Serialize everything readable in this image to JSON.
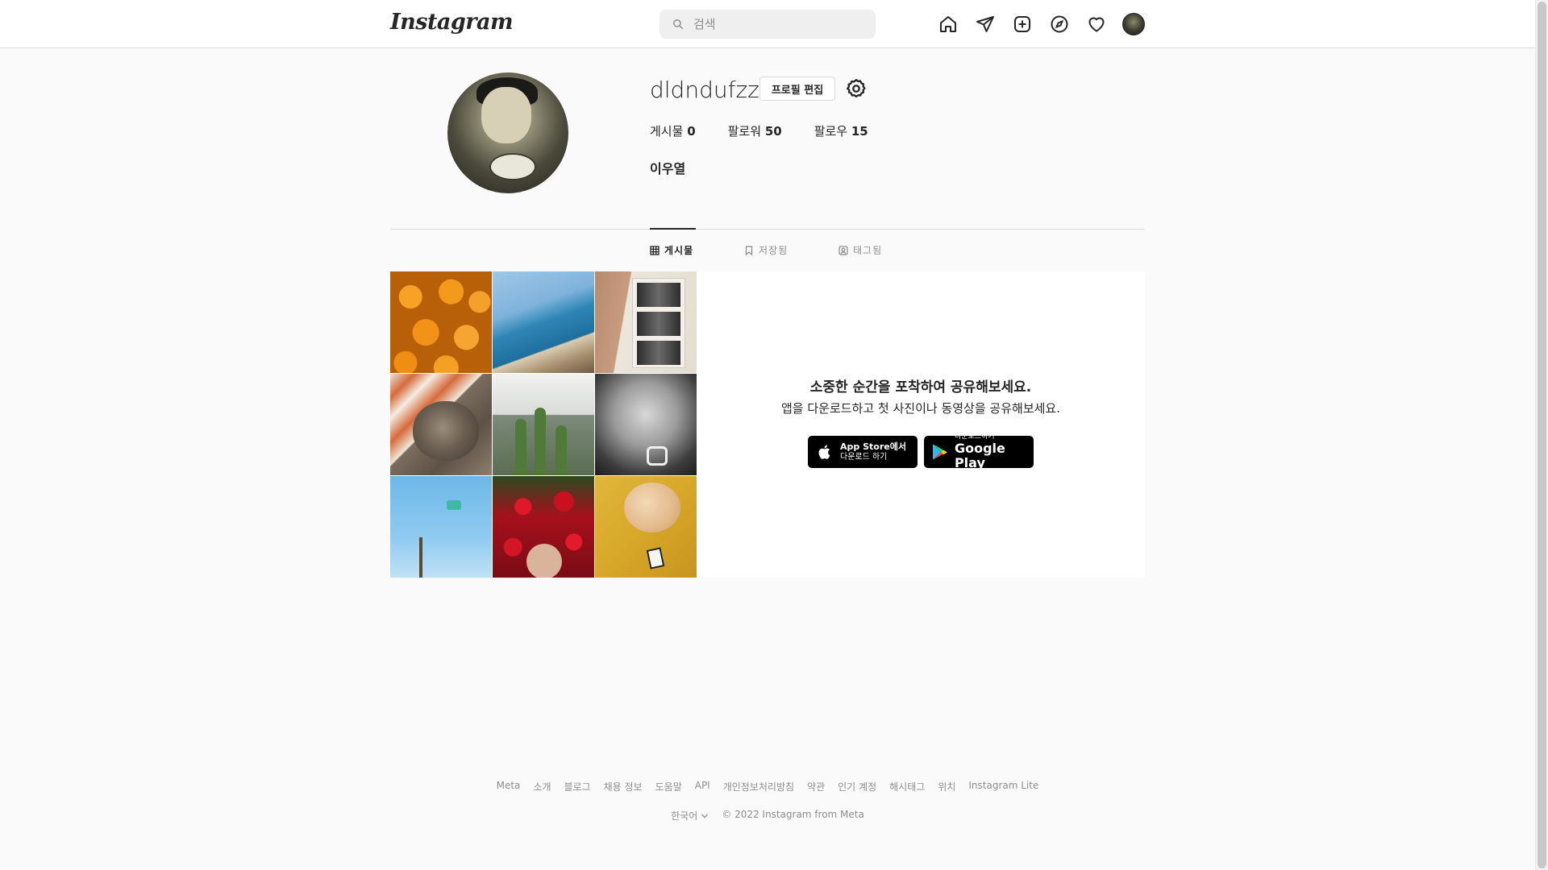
{
  "header": {
    "logo_text": "Instagram",
    "search_placeholder": "검색",
    "nav_icons": [
      "home-icon",
      "direct-message-icon",
      "new-post-icon",
      "explore-icon",
      "activity-heart-icon",
      "profile-avatar"
    ]
  },
  "profile": {
    "username": "dldndufzz",
    "edit_button": "프로필 편집",
    "stats": {
      "posts_label": "게시물",
      "posts_count": "0",
      "followers_label": "팔로워",
      "followers_count": "50",
      "following_label": "팔로우",
      "following_count": "15"
    },
    "full_name": "이우열"
  },
  "tabs": [
    {
      "label": "게시물",
      "icon": "grid-icon",
      "active": true
    },
    {
      "label": "저장됨",
      "icon": "bookmark-icon",
      "active": false
    },
    {
      "label": "태그됨",
      "icon": "tag-icon",
      "active": false
    }
  ],
  "empty_state": {
    "title": "소중한 순간을 포착하여 공유해보세요.",
    "subtitle": "앱을 다운로드하고 첫 사진이나 동영상을 공유해보세요.",
    "app_store": {
      "line1": "App Store에서",
      "line2": "다운로드 하기"
    },
    "google_play": {
      "line1": "다운로드하기",
      "line2": "Google Play"
    }
  },
  "footer": {
    "links": [
      "Meta",
      "소개",
      "블로그",
      "채용 정보",
      "도움말",
      "API",
      "개인정보처리방침",
      "약관",
      "인기 계정",
      "해시태그",
      "위치",
      "Instagram Lite"
    ],
    "language": "한국어",
    "copyright": "© 2022 Instagram from Meta"
  },
  "colors": {
    "background": "#fafafa",
    "text": "#262626",
    "muted": "#8e8e8e",
    "border": "#dbdbdb"
  }
}
